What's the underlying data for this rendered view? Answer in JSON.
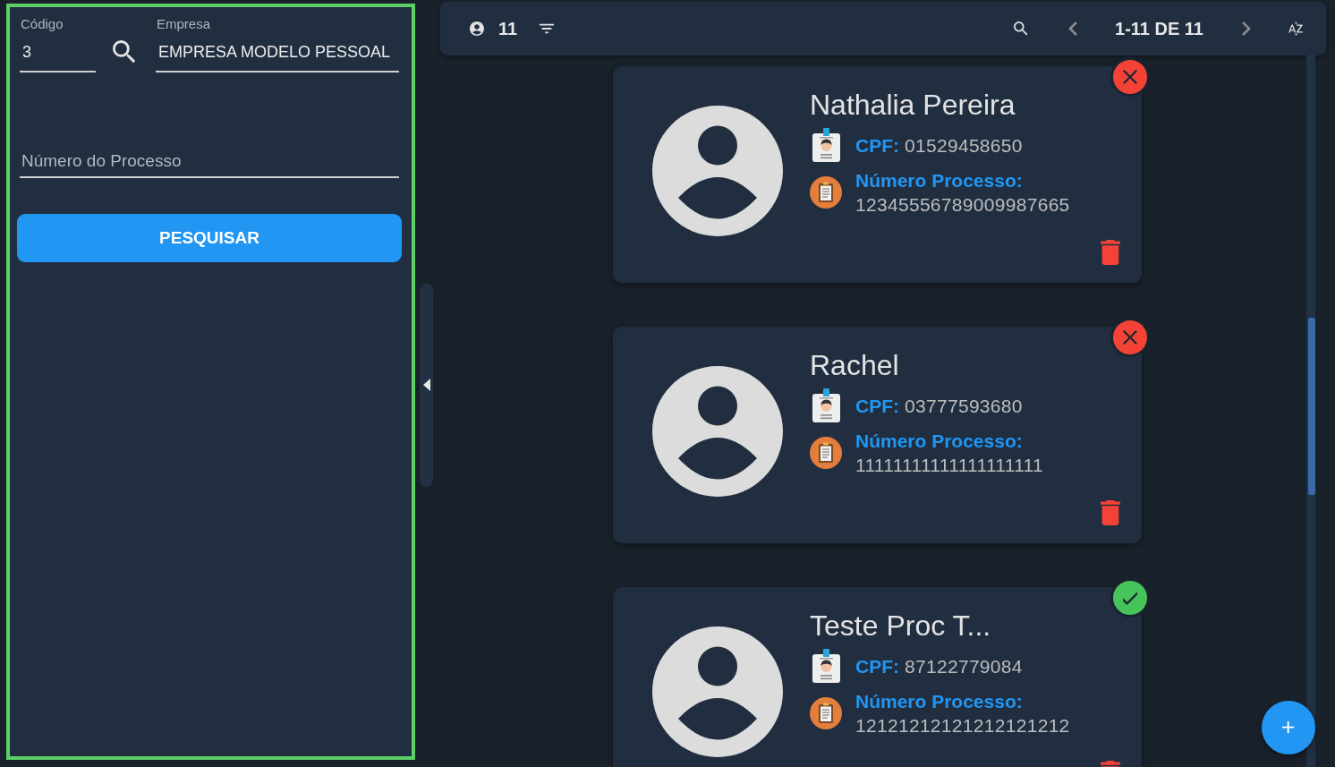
{
  "filters": {
    "code": {
      "label": "Código",
      "value": "3"
    },
    "company": {
      "label": "Empresa",
      "value": "EMPRESA MODELO PESSOAL"
    },
    "process_number": {
      "placeholder": "Número do Processo"
    },
    "search_button": "PESQUISAR"
  },
  "toolbar": {
    "count": "11",
    "pagination": {
      "label": "1-11 DE 11",
      "previous_disabled": true,
      "next_disabled": true
    }
  },
  "records": [
    {
      "name": "Nathalia Pereira",
      "cpf_label": "CPF:",
      "cpf": "01529458650",
      "process_label": "Número Processo:",
      "process_number": "12345556789009987665",
      "approved": false
    },
    {
      "name": "Rachel",
      "cpf_label": "CPF:",
      "cpf": "03777593680",
      "process_label": "Número Processo:",
      "process_number": "11111111111111111111",
      "approved": false
    },
    {
      "name": "Teste Proc T...",
      "cpf_label": "CPF:",
      "cpf": "87122779084",
      "process_label": "Número Processo:",
      "process_number": "12121212121212121212",
      "approved": true
    }
  ]
}
